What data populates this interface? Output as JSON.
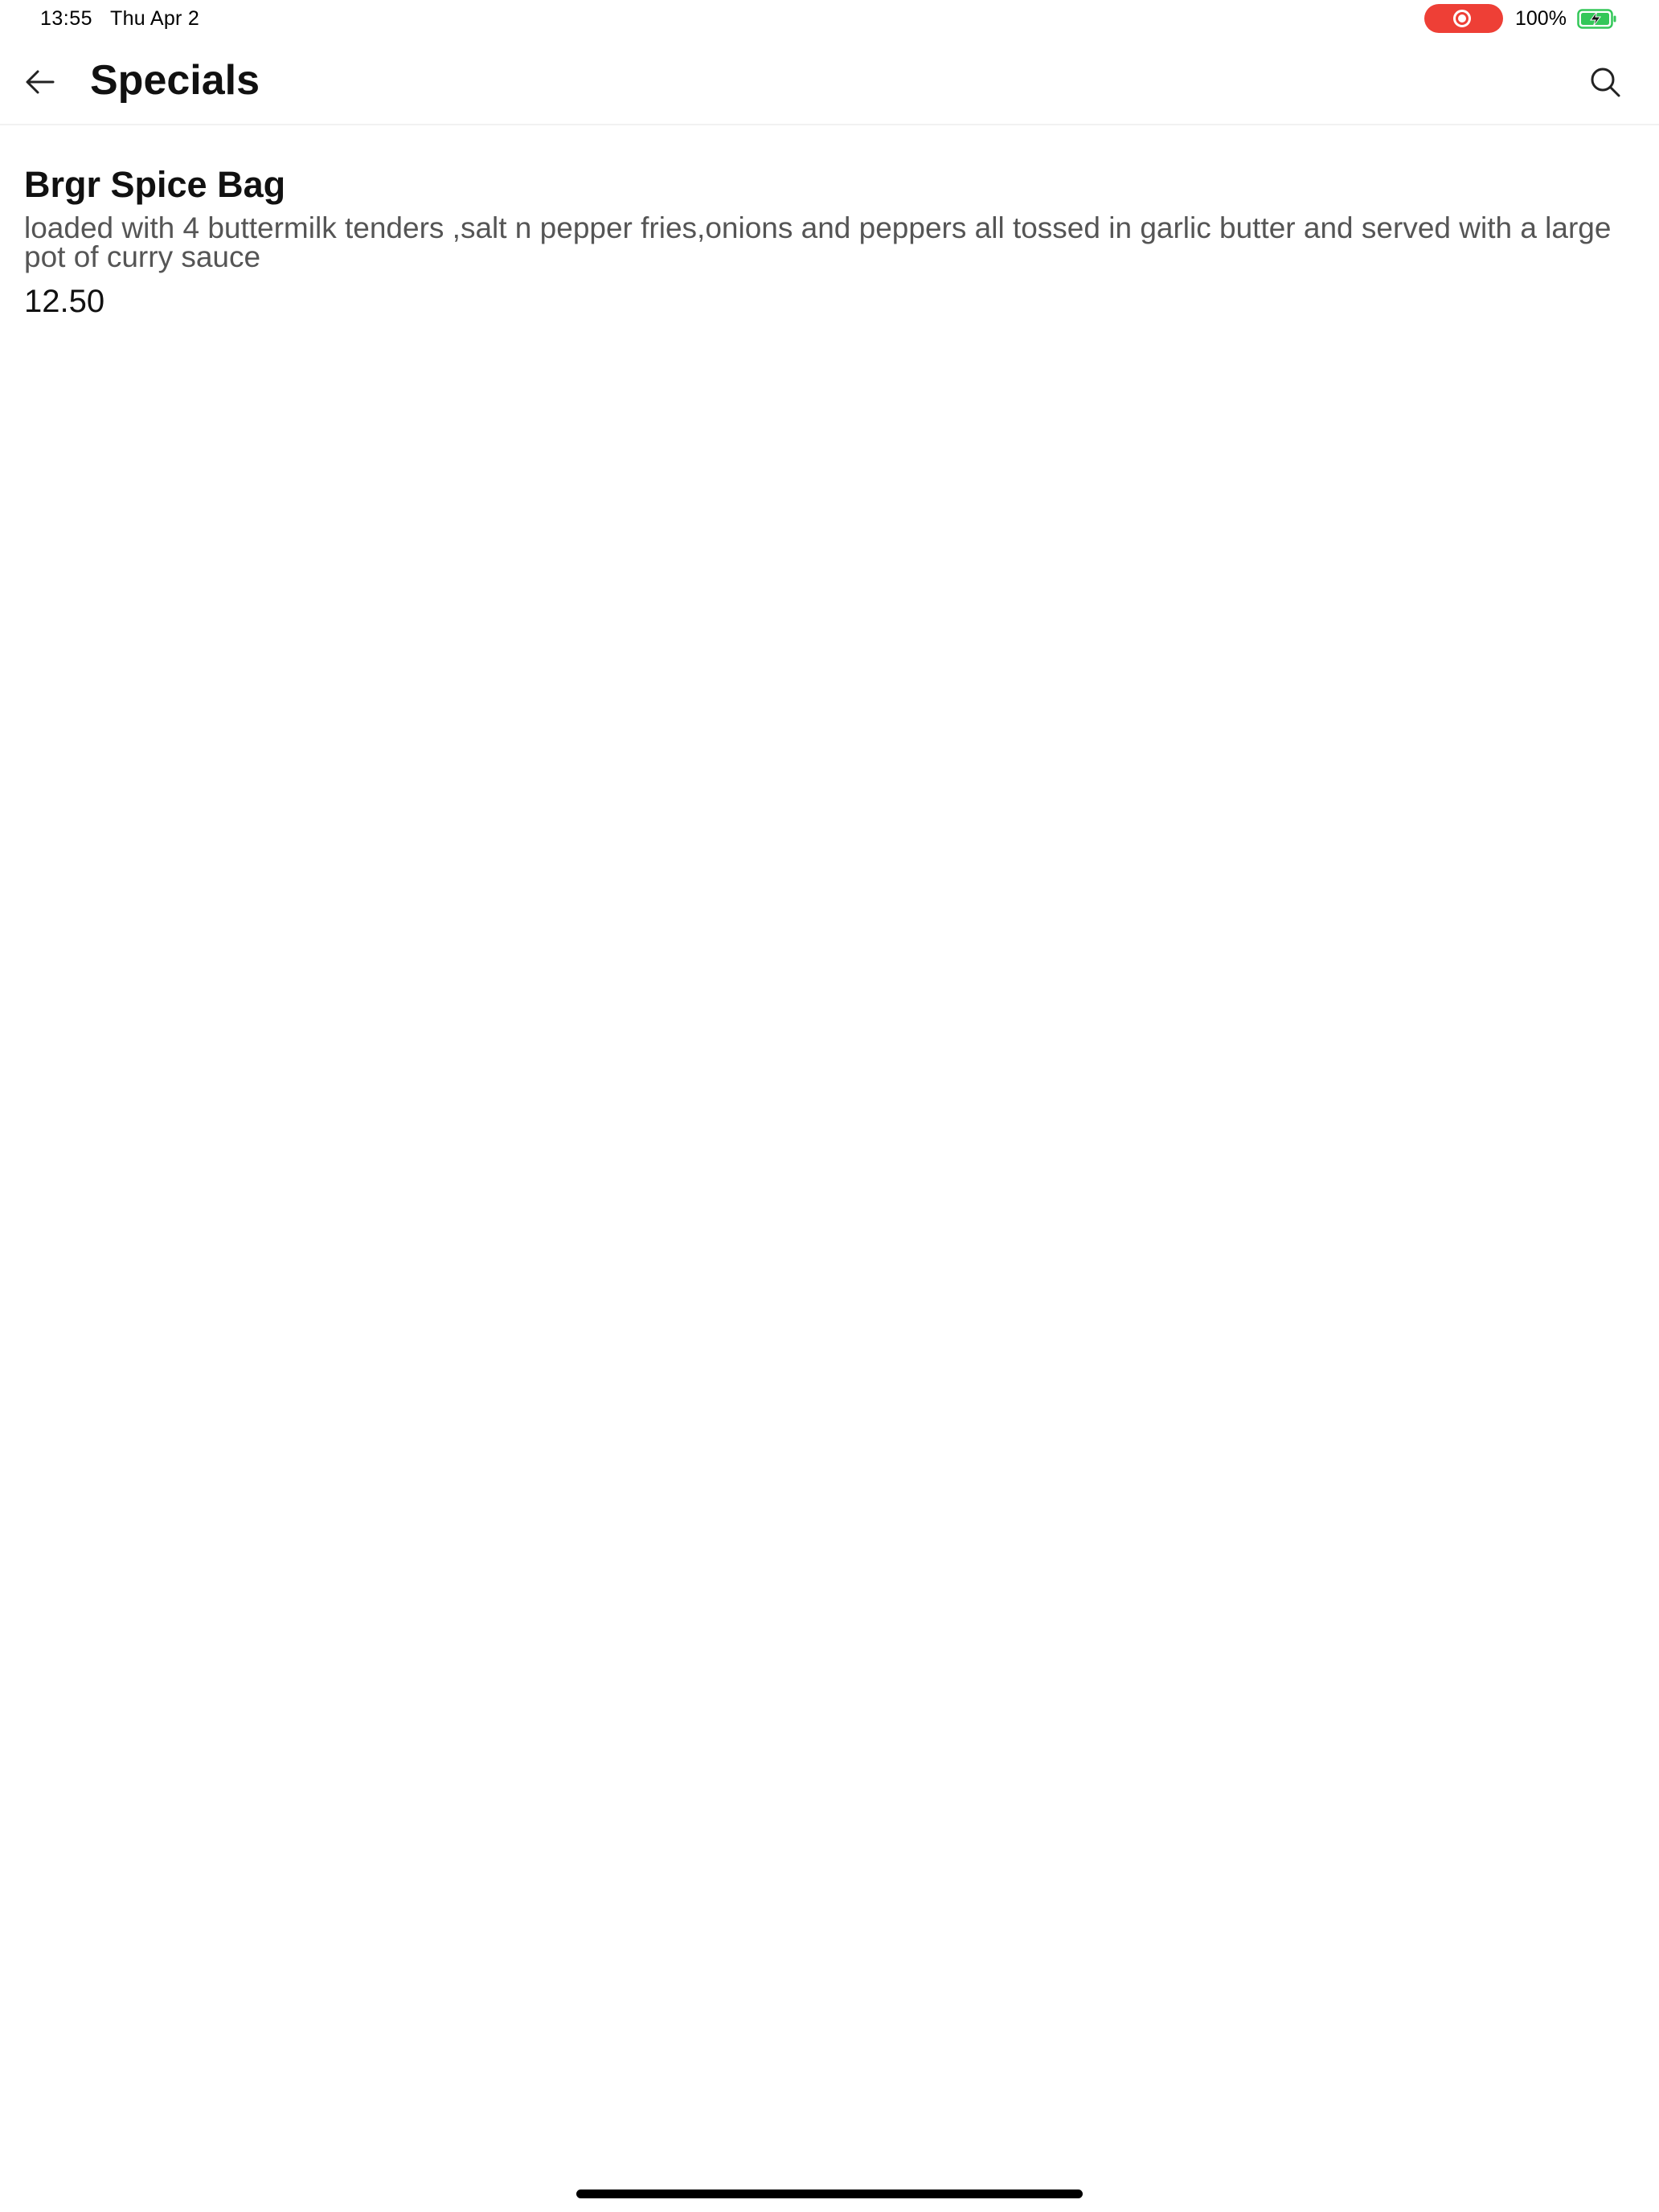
{
  "status_bar": {
    "time": "13:55",
    "date": "Thu Apr 2",
    "battery_percent": "100%",
    "battery_level": 1.0,
    "recording_color": "#ee3f36",
    "battery_color": "#34c759"
  },
  "app_bar": {
    "back_icon": "arrow-left-icon",
    "title": "Specials",
    "search_icon": "search-icon"
  },
  "menu_items": [
    {
      "name": "Brgr Spice Bag",
      "description": "loaded with 4 buttermilk tenders ,salt n pepper fries,onions and peppers all tossed in garlic butter and served with a large pot of curry sauce",
      "price": "12.50"
    }
  ]
}
